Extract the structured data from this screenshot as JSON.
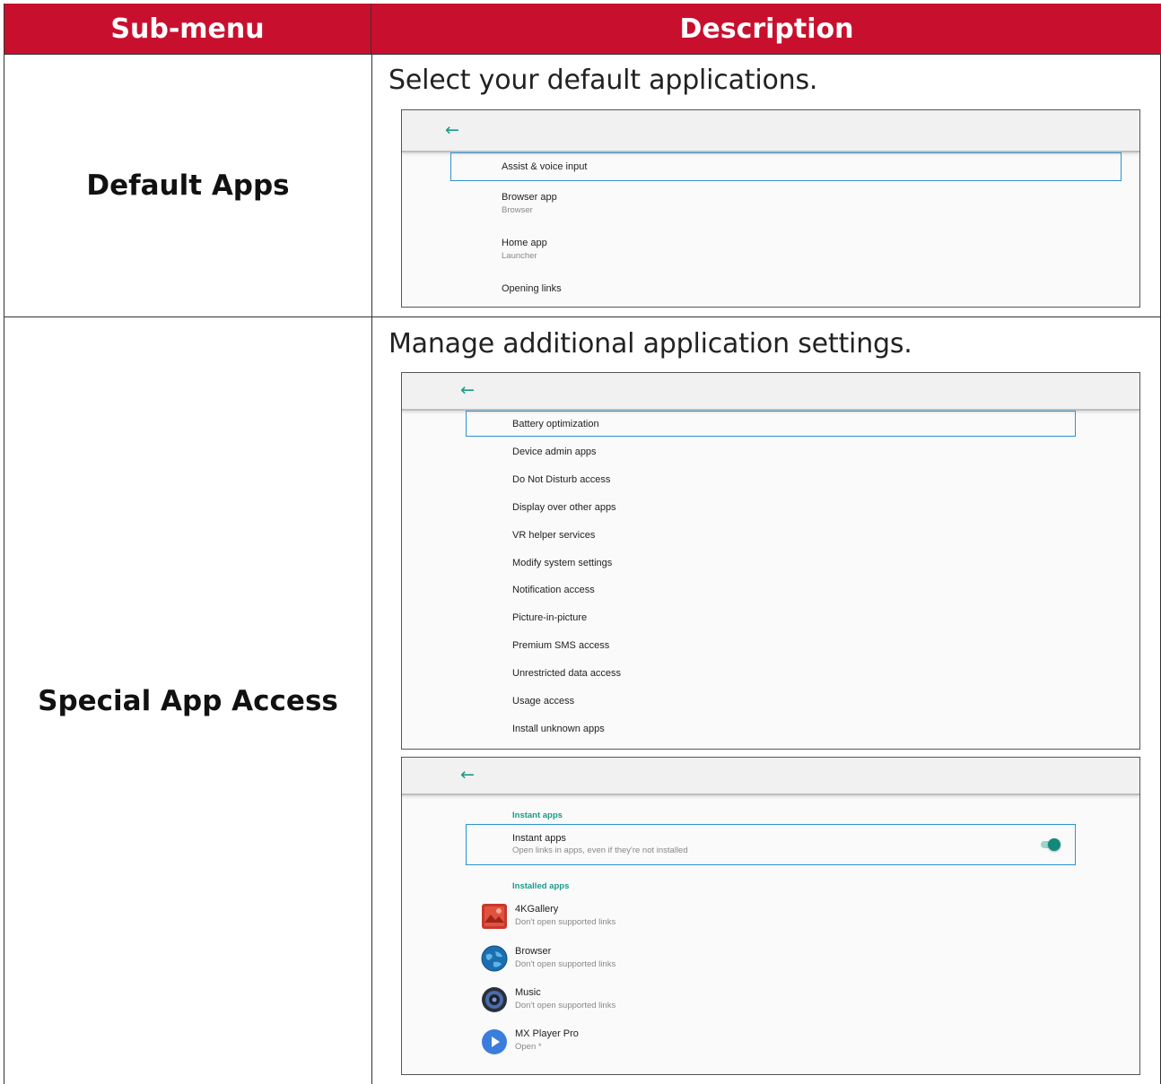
{
  "table": {
    "headers": [
      "Sub-menu",
      "Description"
    ],
    "rows": [
      {
        "submenu": "Default Apps",
        "description": "Select your default applications.",
        "screen": {
          "items": [
            {
              "title": "Assist & voice input",
              "subtitle": ""
            },
            {
              "title": "Browser app",
              "subtitle": "Browser"
            },
            {
              "title": "Home app",
              "subtitle": "Launcher"
            },
            {
              "title": "Opening links",
              "subtitle": ""
            }
          ]
        }
      },
      {
        "submenu": "Special App Access",
        "description": "Manage additional application settings.",
        "screen1": {
          "items": [
            "Battery optimization",
            "Device admin apps",
            "Do Not Disturb access",
            "Display over other apps",
            "VR helper services",
            "Modify system settings",
            "Notification access",
            "Picture-in-picture",
            "Premium SMS access",
            "Unrestricted data access",
            "Usage access",
            "Install unknown apps"
          ]
        },
        "screen2": {
          "instant_category": "Instant apps",
          "instant_item": {
            "title": "Instant apps",
            "subtitle": "Open links in apps, even if they're not installed",
            "toggle_on": true
          },
          "installed_category": "Installed apps",
          "apps": [
            {
              "title": "4KGallery",
              "subtitle": "Don't open supported links",
              "icon": "gallery-icon"
            },
            {
              "title": "Browser",
              "subtitle": "Don't open supported links",
              "icon": "globe-icon"
            },
            {
              "title": "Music",
              "subtitle": "Don't open supported links",
              "icon": "speaker-icon"
            },
            {
              "title": "MX Player Pro",
              "subtitle": "Open *",
              "icon": "play-icon"
            }
          ]
        }
      }
    ]
  },
  "icons": {
    "back": "arrow-left-icon"
  },
  "colors": {
    "header_bg": "#c8102e",
    "accent": "#1a9a8a",
    "focus": "#2b93d1"
  }
}
